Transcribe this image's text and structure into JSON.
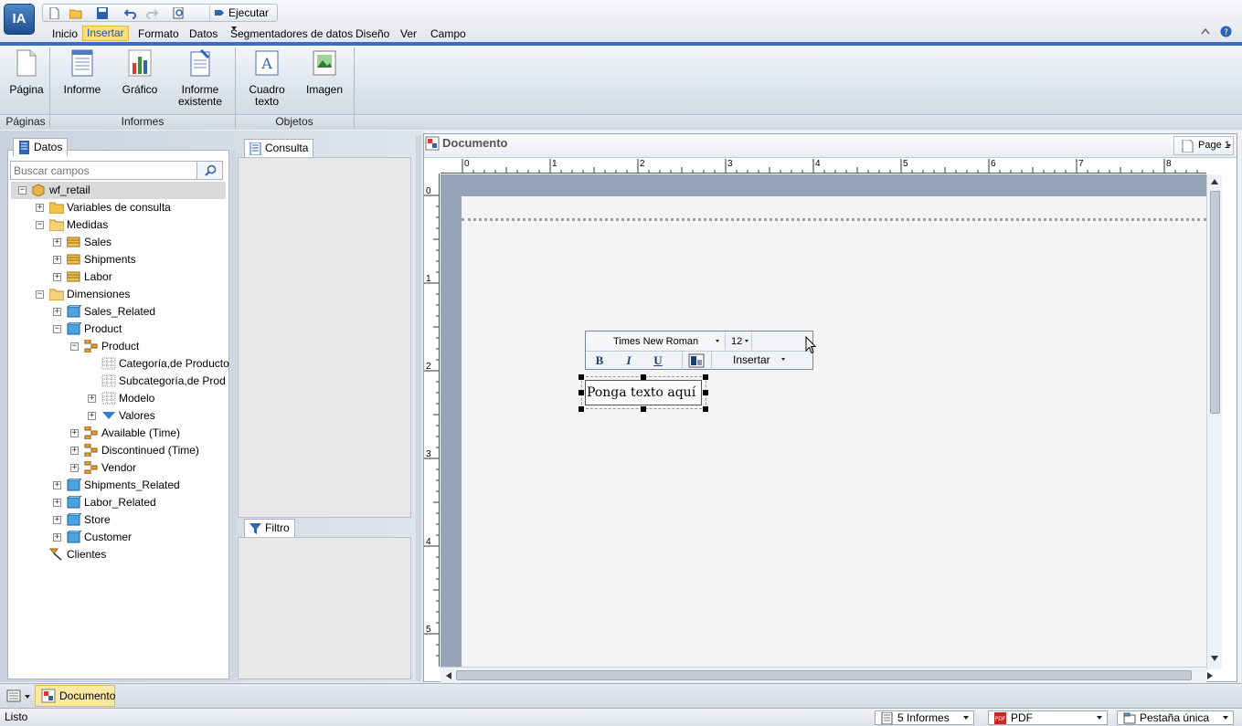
{
  "app": {
    "logo_text": "IA"
  },
  "quick_access": {
    "run_label": "Ejecutar"
  },
  "menu": {
    "items": [
      "Inicio",
      "Insertar",
      "Formato",
      "Datos",
      "Segmentadores de datos",
      "Diseño",
      "Ver",
      "Campo"
    ],
    "active": "Insertar"
  },
  "ribbon": {
    "buttons": {
      "pagina": "Página",
      "informe": "Informe",
      "grafico": "Gráfico",
      "informe_existente_1": "Informe",
      "informe_existente_2": "existente",
      "cuadro_texto_1": "Cuadro",
      "cuadro_texto_2": "texto",
      "imagen": "Imagen"
    },
    "groups": {
      "paginas": "Páginas",
      "informes": "Informes",
      "objetos": "Objetos"
    }
  },
  "datos_panel": {
    "tab_label": "Datos",
    "search_placeholder": "Buscar campos",
    "tree": {
      "root": "wf_retail",
      "variables": "Variables de consulta",
      "medidas": "Medidas",
      "sales": "Sales",
      "shipments": "Shipments",
      "labor": "Labor",
      "dimensiones": "Dimensiones",
      "sales_related": "Sales_Related",
      "product_dim": "Product",
      "product_hier": "Product",
      "categoria": "Categoría,de Producto",
      "subcategoria": "Subcategoría,de Producto",
      "modelo": "Modelo",
      "valores": "Valores",
      "available": "Available (Time)",
      "discontinued": "Discontinued (Time)",
      "vendor": "Vendor",
      "shipments_related": "Shipments_Related",
      "labor_related": "Labor_Related",
      "store": "Store",
      "customer": "Customer",
      "clientes": "Clientes"
    }
  },
  "consulta_panel": {
    "tab_label": "Consulta"
  },
  "filtro_panel": {
    "tab_label": "Filtro"
  },
  "document": {
    "title": "Documento",
    "page_selector": "Page 1",
    "ruler_h": [
      "0",
      "1",
      "2",
      "3",
      "4",
      "5",
      "6",
      "7",
      "8"
    ],
    "ruler_v": [
      "0",
      "1",
      "2",
      "3",
      "4",
      "5"
    ],
    "text_toolbar": {
      "font": "Times New Roman",
      "size": "12",
      "bold": "B",
      "italic": "I",
      "underline": "U",
      "insert_label": "Insertar"
    },
    "textbox_text": "Ponga texto aquí"
  },
  "bottom_tabs": {
    "documento": "Documento"
  },
  "status": {
    "text": "Listo",
    "informes": "5 Informes",
    "format": "PDF",
    "tab_mode": "Pestaña única"
  },
  "colors": {
    "accent": "#3a6fbf",
    "active_menu": "#fbe07a"
  }
}
